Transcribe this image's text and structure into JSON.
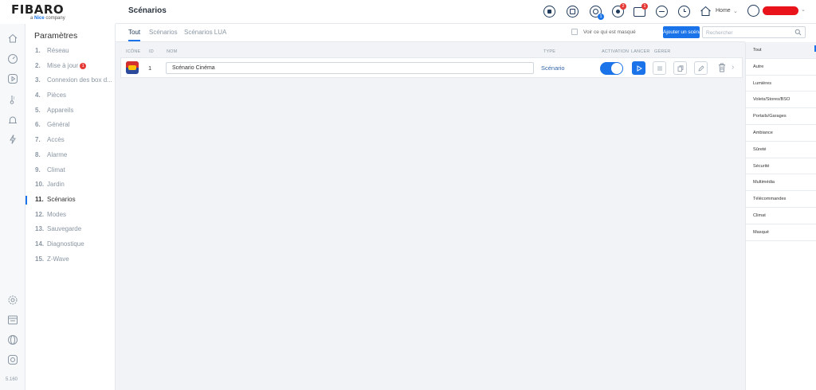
{
  "app": {
    "logo": "FIBARO",
    "logo_sub_prefix": "a",
    "logo_sub_brand": "Nice",
    "logo_sub_suffix": "company",
    "version": "5.160",
    "accent_color": "#1a73e8",
    "badge_color": "#e53935"
  },
  "header": {
    "title": "Scénarios",
    "icons": [
      {
        "name": "sun-icon"
      },
      {
        "name": "house-shield-icon"
      },
      {
        "name": "user-group-icon",
        "badge": "1"
      },
      {
        "name": "drop-icon",
        "badge": "2"
      },
      {
        "name": "mail-icon",
        "badge": "1"
      },
      {
        "name": "minus-circle-icon"
      },
      {
        "name": "clock-icon"
      }
    ],
    "home_label": "Home"
  },
  "sidebar": {
    "title": "Paramètres",
    "items": [
      {
        "num": "1.",
        "label": "Réseau"
      },
      {
        "num": "2.",
        "label": "Mise à jour",
        "badge": "1"
      },
      {
        "num": "3.",
        "label": "Connexion des box d..."
      },
      {
        "num": "4.",
        "label": "Pièces"
      },
      {
        "num": "5.",
        "label": "Appareils"
      },
      {
        "num": "6.",
        "label": "Général"
      },
      {
        "num": "7.",
        "label": "Accès"
      },
      {
        "num": "8.",
        "label": "Alarme"
      },
      {
        "num": "9.",
        "label": "Climat"
      },
      {
        "num": "10.",
        "label": "Jardin"
      },
      {
        "num": "11.",
        "label": "Scénarios",
        "active": true
      },
      {
        "num": "12.",
        "label": "Modes"
      },
      {
        "num": "13.",
        "label": "Sauvegarde"
      },
      {
        "num": "14.",
        "label": "Diagnostique"
      },
      {
        "num": "15.",
        "label": "Z-Wave"
      }
    ]
  },
  "tabs": {
    "items": [
      {
        "label": "Tout",
        "active": true
      },
      {
        "label": "Scénarios"
      },
      {
        "label": "Scénarios LUA"
      }
    ],
    "show_hidden_label": "Voir ce qui est masqué",
    "add_button": "Ajouter un scénario",
    "search_placeholder": "Rechercher"
  },
  "table": {
    "headers": {
      "icon": "ICÔNE",
      "id": "ID",
      "name": "NOM",
      "type": "TYPE",
      "activation": "ACTIVATION",
      "run": "LANCER",
      "manage": "GÉRER"
    },
    "rows": [
      {
        "id": "1",
        "name": "Scénario Cinéma",
        "type": "Scénario",
        "activation": true
      }
    ]
  },
  "filters": {
    "items": [
      {
        "label": "Tout",
        "active": true
      },
      {
        "label": "Autre"
      },
      {
        "label": "Lumières"
      },
      {
        "label": "Volets/Stores/BSO"
      },
      {
        "label": "Portails/Garages"
      },
      {
        "label": "Ambiance"
      },
      {
        "label": "Sûreté"
      },
      {
        "label": "Sécurité"
      },
      {
        "label": "Multimédia"
      },
      {
        "label": "Télécommandes"
      },
      {
        "label": "Climat"
      },
      {
        "label": "Masqué"
      }
    ]
  }
}
